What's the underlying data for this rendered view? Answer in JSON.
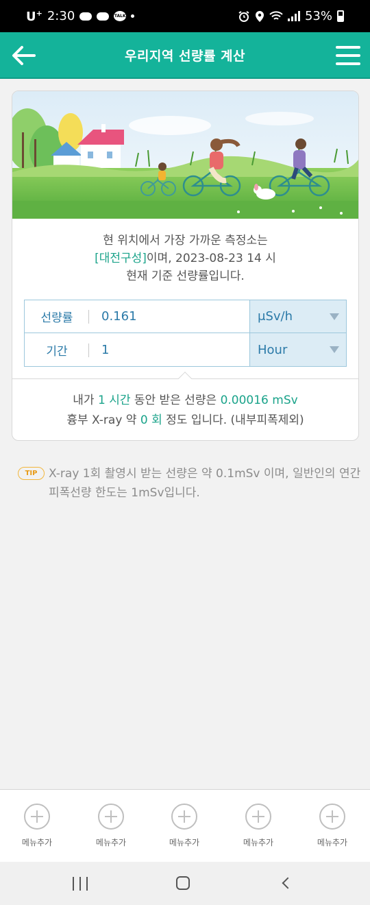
{
  "status_bar": {
    "carrier": "U",
    "carrier_sup": "+",
    "time": "2:30",
    "battery": "53%"
  },
  "header": {
    "title": "우리지역 선량률 계산",
    "back_icon": "arrow-left-icon",
    "menu_icon": "hamburger-menu-icon",
    "bg_color": "#14b39a"
  },
  "info": {
    "line1": "현 위치에서 가장 가까운 측정소는",
    "station": "[대전구성]",
    "line2_rest": "이며, 2023-08-23 14 시",
    "line3": "현재 기준 선량률입니다."
  },
  "calculator": {
    "dose_rate_label": "선량률",
    "dose_rate_value": "0.161",
    "dose_rate_unit": "μSv/h",
    "period_label": "기간",
    "period_value": "1",
    "period_unit": "Hour"
  },
  "result": {
    "p1": "내가",
    "hours": "1 시간",
    "p2": "동안 받은 선량은",
    "dose": "0.00016 mSv",
    "p3": "흉부 X-ray 약",
    "xray_count": "0 회",
    "p4": "정도 입니다. (내부피폭제외)"
  },
  "tip": {
    "badge": "TIP",
    "text": "X-ray 1회 촬영시 받는 선량은 약 0.1mSv 이며, 일반인의 연간 피폭선량 한도는 1mSv입니다."
  },
  "bottom_menu": {
    "items": [
      {
        "label": "메뉴추가"
      },
      {
        "label": "메뉴추가"
      },
      {
        "label": "메뉴추가"
      },
      {
        "label": "메뉴추가"
      },
      {
        "label": "메뉴추가"
      }
    ]
  }
}
